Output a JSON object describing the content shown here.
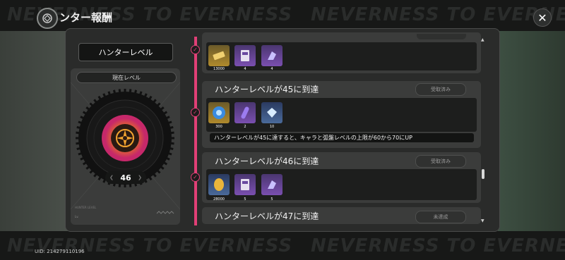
{
  "header": {
    "title": "ンター報酬",
    "close_label": "✕",
    "watermark_left": "NEVERNESS TO EVERNESS",
    "watermark_right": "NEVERNESS TO EVERNESS"
  },
  "footer": {
    "uid": "UID: 214279110196",
    "watermark_left": "NEVERNESS TO EVERNESS",
    "watermark_right": "NEVERNESS TO EVERNESS"
  },
  "left_panel": {
    "section_title": "ハンターレベル",
    "current_label": "現在レベル",
    "level": "46",
    "footer_small_a": "HUNTER LEVEL",
    "footer_small_b": "Lv.",
    "accent_color": "#e13f76"
  },
  "rewards": [
    {
      "title": "",
      "status": "",
      "items": [
        {
          "icon": "ticket-icon",
          "qty": "13000",
          "rarity": "gold"
        },
        {
          "icon": "card-icon",
          "qty": "4",
          "rarity": "purple"
        },
        {
          "icon": "crystal-icon",
          "qty": "4",
          "rarity": "purple"
        }
      ],
      "description": ""
    },
    {
      "title": "ハンターレベルが45に到達",
      "status": "受取済み",
      "items": [
        {
          "icon": "orb-icon",
          "qty": "300",
          "rarity": "gold"
        },
        {
          "icon": "capsule-icon",
          "qty": "2",
          "rarity": "purple"
        },
        {
          "icon": "gem-icon",
          "qty": "10",
          "rarity": "blue"
        }
      ],
      "description": "ハンターレベルが45に達すると、キャラと弧盤レベルの上限が60から70にUP"
    },
    {
      "title": "ハンターレベルが46に到達",
      "status": "受取済み",
      "items": [
        {
          "icon": "coin-icon",
          "qty": "28000",
          "rarity": "blue"
        },
        {
          "icon": "card-icon",
          "qty": "5",
          "rarity": "purple"
        },
        {
          "icon": "crystal-icon",
          "qty": "5",
          "rarity": "purple"
        }
      ],
      "description": ""
    },
    {
      "title": "ハンターレベルが47に到達",
      "status": "未達成",
      "items": [],
      "description": ""
    }
  ]
}
